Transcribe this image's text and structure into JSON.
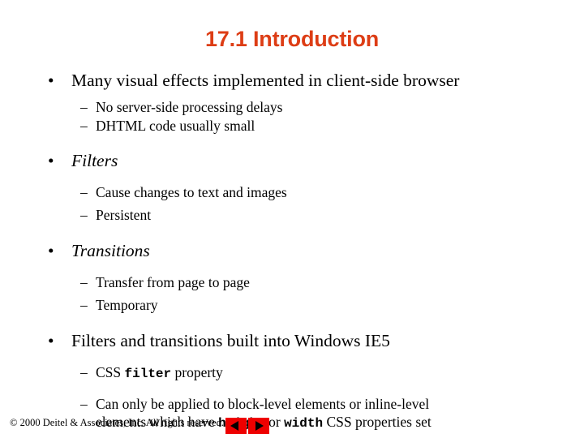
{
  "slide": {
    "title": "17.1 Introduction",
    "title_color": "#dd3d15",
    "background_color": "#ffffff",
    "bullet_marker": "•",
    "dash_marker": "–"
  },
  "bullets": [
    {
      "text": "Many visual effects implemented in client-side browser",
      "style": "normal",
      "subs": [
        {
          "text": "No server-side processing delays"
        },
        {
          "text": "DHTML code usually small"
        }
      ]
    },
    {
      "text": "Filters",
      "style": "italic",
      "subs": [
        {
          "text": "Cause changes to text and images"
        },
        {
          "text": "Persistent"
        }
      ]
    },
    {
      "text": "Transitions",
      "style": "italic",
      "subs": [
        {
          "text": "Transfer from page to page"
        },
        {
          "text": "Temporary"
        }
      ]
    },
    {
      "text": "Filters and transitions built into Windows IE5",
      "style": "normal",
      "subs": [
        {
          "prefix": "CSS ",
          "code": "filter",
          "suffix": " property"
        },
        {
          "line1": "Can only be applied to block-level elements or inline-level",
          "line2_prefix": "elements which have ",
          "line2_code1": "height",
          "line2_mid": " or ",
          "line2_code2": "width",
          "line2_suffix": " CSS properties set"
        }
      ]
    }
  ],
  "footer": {
    "copyright": "© 2000 Deitel & Associates, Inc.  All rights reserved.",
    "prev_label": "Previous slide",
    "next_label": "Next slide",
    "button_color": "#ee0000",
    "triangle_color": "#000000"
  }
}
